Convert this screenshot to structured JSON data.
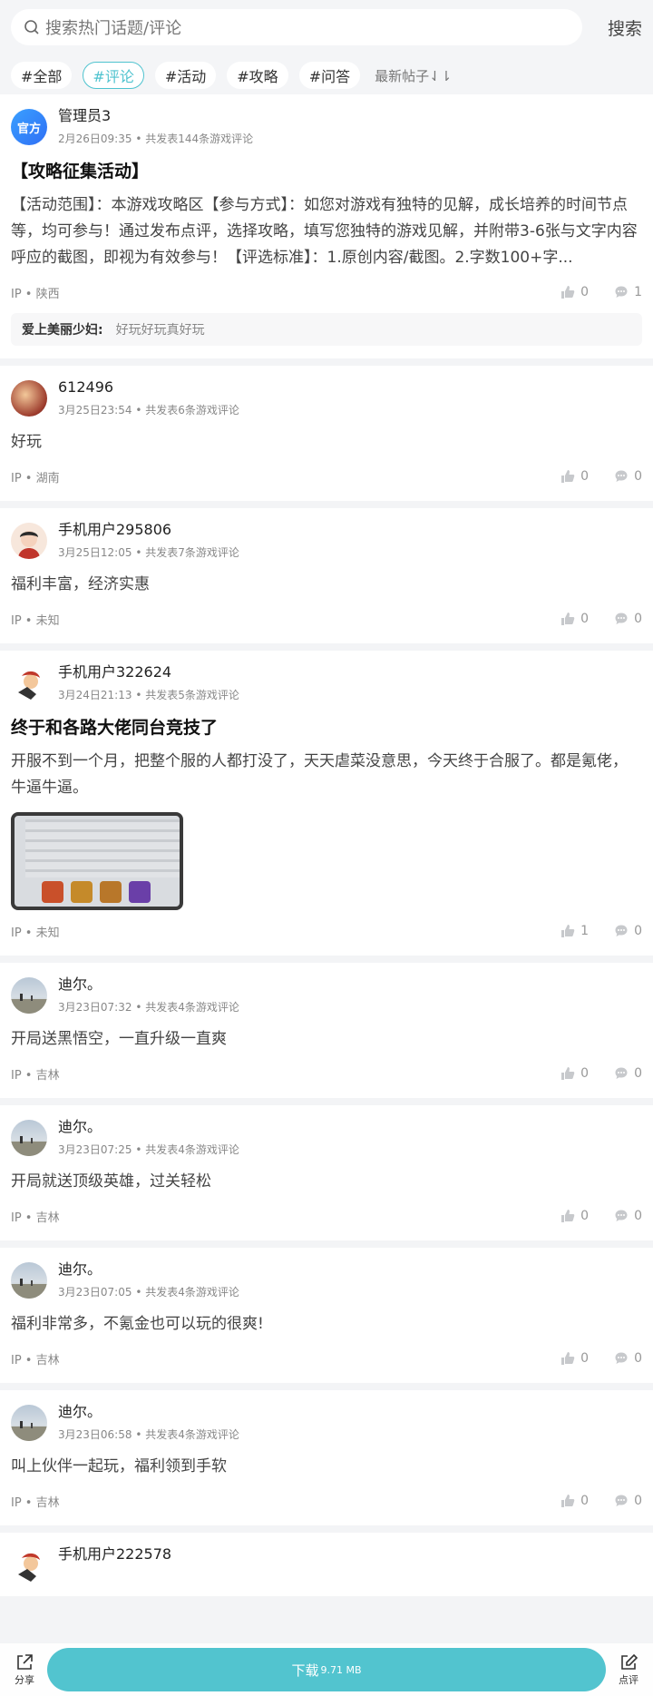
{
  "search": {
    "placeholder": "搜索热门话题/评论",
    "button": "搜索"
  },
  "tags": [
    "#全部",
    "#评论",
    "#活动",
    "#攻略",
    "#问答"
  ],
  "active_tag_index": 1,
  "sort_label": "最新帖子⇃⇂",
  "posts": [
    {
      "avatar": "official",
      "avatar_text": "官方",
      "name": "管理员3",
      "time": "2月26日09:35",
      "count": "共发表144条游戏评论",
      "title": "【攻略征集活动】",
      "content": "【活动范围】：本游戏攻略区【参与方式】：如您对游戏有独特的见解，成长培养的时间节点等，均可参与！通过发布点评，选择攻略，填写您独特的游戏见解，并附带3-6张与文字内容呼应的截图，即视为有效参与！【评选标准】：1.原创内容/截图。2.字数100+字...",
      "ip": "陕西",
      "likes": "0",
      "comments": "1",
      "reply": {
        "who": "爱上美丽少妇:",
        "text": "好玩好玩真好玩"
      }
    },
    {
      "avatar": "a1",
      "name": "612496",
      "time": "3月25日23:54",
      "count": "共发表6条游戏评论",
      "content": "好玩",
      "ip": "湖南",
      "likes": "0",
      "comments": "0"
    },
    {
      "avatar": "a2",
      "name": "手机用户295806",
      "time": "3月25日12:05",
      "count": "共发表7条游戏评论",
      "content": "福利丰富，经济实惠",
      "ip": "未知",
      "likes": "0",
      "comments": "0"
    },
    {
      "avatar": "a3",
      "name": "手机用户322624",
      "time": "3月24日21:13",
      "count": "共发表5条游戏评论",
      "title": "终于和各路大佬同台竞技了",
      "content": "开服不到一个月，把整个服的人都打没了，天天虐菜没意思，今天终于合服了。都是氪佬，牛逼牛逼。",
      "has_image": true,
      "ip": "未知",
      "likes": "1",
      "comments": "0"
    },
    {
      "avatar": "a4",
      "name": "迪尔。",
      "time": "3月23日07:32",
      "count": "共发表4条游戏评论",
      "content": "开局送黑悟空，一直升级一直爽",
      "ip": "吉林",
      "likes": "0",
      "comments": "0"
    },
    {
      "avatar": "a4",
      "name": "迪尔。",
      "time": "3月23日07:25",
      "count": "共发表4条游戏评论",
      "content": "开局就送顶级英雄，过关轻松",
      "ip": "吉林",
      "likes": "0",
      "comments": "0"
    },
    {
      "avatar": "a4",
      "name": "迪尔。",
      "time": "3月23日07:05",
      "count": "共发表4条游戏评论",
      "content": "福利非常多，不氪金也可以玩的很爽!",
      "ip": "吉林",
      "likes": "0",
      "comments": "0"
    },
    {
      "avatar": "a4",
      "name": "迪尔。",
      "time": "3月23日06:58",
      "count": "共发表4条游戏评论",
      "content": "叫上伙伴一起玩，福利领到手软",
      "ip": "吉林",
      "likes": "0",
      "comments": "0"
    },
    {
      "avatar": "a3",
      "name": "手机用户222578"
    }
  ],
  "ip_prefix": "IP • ",
  "bottom": {
    "share": "分享",
    "download": "下载",
    "size": "9.71 MB",
    "review": "点评"
  },
  "colors": {
    "accent": "#52c4cf",
    "tag_active": "#4fc3cf"
  }
}
